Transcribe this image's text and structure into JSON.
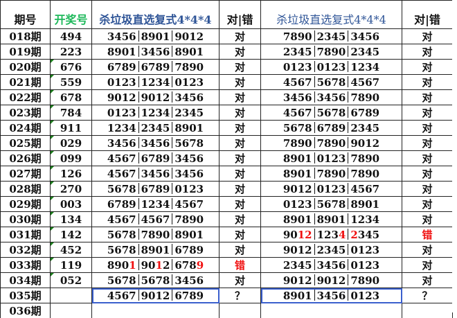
{
  "headers": {
    "period": "期号",
    "draw": "开奖号",
    "kill1": "杀垃圾直选复式4*4*4",
    "result1": "对|错",
    "kill2": "杀垃圾直选复式4*4*4",
    "result2": "对|错"
  },
  "rows": [
    {
      "period": "018期",
      "draw": "494",
      "kill1": [
        [
          [
            "3456"
          ]
        ],
        [
          [
            "8901"
          ]
        ],
        [
          [
            "9012"
          ]
        ]
      ],
      "result1": "对",
      "kill2": [
        [
          [
            "7890"
          ]
        ],
        [
          [
            "2345"
          ]
        ],
        [
          [
            "3456"
          ]
        ]
      ],
      "result2": "对"
    },
    {
      "period": "019期",
      "draw": "223",
      "kill1": [
        [
          [
            "8901"
          ]
        ],
        [
          [
            "3456"
          ]
        ],
        [
          [
            "8901"
          ]
        ]
      ],
      "result1": "对",
      "kill2": [
        [
          [
            "2345"
          ]
        ],
        [
          [
            "7890"
          ]
        ],
        [
          [
            "2345"
          ]
        ]
      ],
      "result2": "对"
    },
    {
      "period": "020期",
      "draw": "676",
      "kill1": [
        [
          [
            "6789"
          ]
        ],
        [
          [
            "6789"
          ]
        ],
        [
          [
            "7890"
          ]
        ]
      ],
      "result1": "对",
      "kill2": [
        [
          [
            "0123"
          ]
        ],
        [
          [
            "0123"
          ]
        ],
        [
          [
            "1234"
          ]
        ]
      ],
      "result2": "对"
    },
    {
      "period": "021期",
      "draw": "559",
      "kill1": [
        [
          [
            "0123"
          ]
        ],
        [
          [
            "1234"
          ]
        ],
        [
          [
            "0123"
          ]
        ]
      ],
      "result1": "对",
      "kill2": [
        [
          [
            "4567"
          ]
        ],
        [
          [
            "5678"
          ]
        ],
        [
          [
            "4567"
          ]
        ]
      ],
      "result2": "对"
    },
    {
      "period": "022期",
      "draw": "678",
      "kill1": [
        [
          [
            "9012"
          ]
        ],
        [
          [
            "9012"
          ]
        ],
        [
          [
            "3456"
          ]
        ]
      ],
      "result1": "对",
      "kill2": [
        [
          [
            "3456"
          ]
        ],
        [
          [
            "3456"
          ]
        ],
        [
          [
            "7890"
          ]
        ]
      ],
      "result2": "对"
    },
    {
      "period": "023期",
      "draw": "784",
      "kill1": [
        [
          [
            "0123"
          ]
        ],
        [
          [
            "1234"
          ]
        ],
        [
          [
            "2345"
          ]
        ]
      ],
      "result1": "对",
      "kill2": [
        [
          [
            "4567"
          ]
        ],
        [
          [
            "5678"
          ]
        ],
        [
          [
            "6789"
          ]
        ]
      ],
      "result2": "对"
    },
    {
      "period": "024期",
      "draw": "911",
      "kill1": [
        [
          [
            "1234"
          ]
        ],
        [
          [
            "2345"
          ]
        ],
        [
          [
            "8901"
          ]
        ]
      ],
      "result1": "对",
      "kill2": [
        [
          [
            "5678"
          ]
        ],
        [
          [
            "6789"
          ]
        ],
        [
          [
            "2345"
          ]
        ]
      ],
      "result2": "对"
    },
    {
      "period": "025期",
      "draw": "029",
      "kill1": [
        [
          [
            "3456"
          ]
        ],
        [
          [
            "3456"
          ]
        ],
        [
          [
            "5678"
          ]
        ]
      ],
      "result1": "对",
      "kill2": [
        [
          [
            "7890"
          ]
        ],
        [
          [
            "7890"
          ]
        ],
        [
          [
            "9012"
          ]
        ]
      ],
      "result2": "对"
    },
    {
      "period": "026期",
      "draw": "099",
      "kill1": [
        [
          [
            "4567"
          ]
        ],
        [
          [
            "6789"
          ]
        ],
        [
          [
            "3456"
          ]
        ]
      ],
      "result1": "对",
      "kill2": [
        [
          [
            "8901"
          ]
        ],
        [
          [
            "0123"
          ]
        ],
        [
          [
            "7890"
          ]
        ]
      ],
      "result2": "对"
    },
    {
      "period": "027期",
      "draw": "126",
      "kill1": [
        [
          [
            "4567"
          ]
        ],
        [
          [
            "3456"
          ]
        ],
        [
          [
            "3456"
          ]
        ]
      ],
      "result1": "对",
      "kill2": [
        [
          [
            "8901"
          ]
        ],
        [
          [
            "7890"
          ]
        ],
        [
          [
            "7890"
          ]
        ]
      ],
      "result2": "对"
    },
    {
      "period": "028期",
      "draw": "270",
      "kill1": [
        [
          [
            "5678"
          ]
        ],
        [
          [
            "6789"
          ]
        ],
        [
          [
            "0123"
          ]
        ]
      ],
      "result1": "对",
      "kill2": [
        [
          [
            "9012"
          ]
        ],
        [
          [
            "0123"
          ]
        ],
        [
          [
            "4567"
          ]
        ]
      ],
      "result2": "对"
    },
    {
      "period": "029期",
      "draw": "003",
      "kill1": [
        [
          [
            "6789"
          ]
        ],
        [
          [
            "1234"
          ]
        ],
        [
          [
            "4567"
          ]
        ]
      ],
      "result1": "对",
      "kill2": [
        [
          [
            "0123"
          ]
        ],
        [
          [
            "5678"
          ]
        ],
        [
          [
            "8901"
          ]
        ]
      ],
      "result2": "对"
    },
    {
      "period": "030期",
      "draw": "134",
      "kill1": [
        [
          [
            "4567"
          ]
        ],
        [
          [
            "4567"
          ]
        ],
        [
          [
            "7890"
          ]
        ]
      ],
      "result1": "对",
      "kill2": [
        [
          [
            "8901"
          ]
        ],
        [
          [
            "8901"
          ]
        ],
        [
          [
            "1234"
          ]
        ]
      ],
      "result2": "对"
    },
    {
      "period": "031期",
      "draw": "142",
      "kill1": [
        [
          [
            "5678"
          ]
        ],
        [
          [
            "7890"
          ]
        ],
        [
          [
            "8901"
          ]
        ]
      ],
      "result1": "对",
      "kill2": [
        [
          [
            "90"
          ],
          [
            "12",
            "red"
          ]
        ],
        [
          [
            "123"
          ],
          [
            "4",
            "red"
          ]
        ],
        [
          [
            "2",
            "red"
          ],
          [
            "345"
          ]
        ]
      ],
      "result2": "错",
      "result2_red": true
    },
    {
      "period": "032期",
      "draw": "452",
      "kill1": [
        [
          [
            "5678"
          ]
        ],
        [
          [
            "8901"
          ]
        ],
        [
          [
            "6789"
          ]
        ]
      ],
      "result1": "对",
      "kill2": [
        [
          [
            "9012"
          ]
        ],
        [
          [
            "2345"
          ]
        ],
        [
          [
            "0123"
          ]
        ]
      ],
      "result2": "对"
    },
    {
      "period": "033期",
      "draw": "119",
      "kill1": [
        [
          [
            "890"
          ],
          [
            "1",
            "red"
          ]
        ],
        [
          [
            "90"
          ],
          [
            "1",
            "red"
          ],
          [
            "2"
          ]
        ],
        [
          [
            "678"
          ],
          [
            "9",
            "red"
          ]
        ]
      ],
      "result1": "错",
      "result1_red": true,
      "kill2": [
        [
          [
            "2345"
          ]
        ],
        [
          [
            "3456"
          ]
        ],
        [
          [
            "0123"
          ]
        ]
      ],
      "result2": "对"
    },
    {
      "period": "034期",
      "draw": "052",
      "kill1": [
        [
          [
            "5678"
          ]
        ],
        [
          [
            "5678"
          ]
        ],
        [
          [
            "3456"
          ]
        ]
      ],
      "result1": "对",
      "kill2": [
        [
          [
            "9012"
          ]
        ],
        [
          [
            "9012"
          ]
        ],
        [
          [
            "7890"
          ]
        ]
      ],
      "result2": "对"
    },
    {
      "period": "035期",
      "draw": "",
      "kill1": [
        [
          [
            "4567"
          ]
        ],
        [
          [
            "9012"
          ]
        ],
        [
          [
            "6789"
          ]
        ]
      ],
      "result1": "？",
      "kill2": [
        [
          [
            "8901"
          ]
        ],
        [
          [
            "3456"
          ]
        ],
        [
          [
            "0123"
          ]
        ]
      ],
      "result2": "？",
      "highlight": true
    },
    {
      "period": "036期",
      "draw": "",
      "kill1": [],
      "result1": "",
      "kill2": [],
      "result2": ""
    }
  ]
}
